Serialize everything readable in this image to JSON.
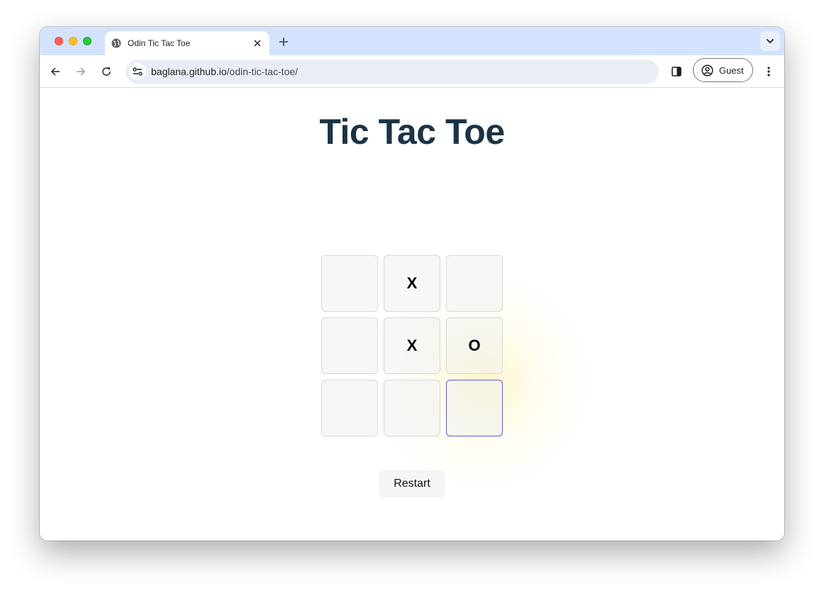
{
  "browser": {
    "tab": {
      "title": "Odin Tic Tac Toe",
      "favicon": "globe-icon"
    },
    "address_bar": {
      "host": "baglana.github.io",
      "path": "/odin-tic-tac-toe/"
    },
    "profile": {
      "label": "Guest"
    }
  },
  "page": {
    "title": "Tic Tac Toe",
    "board": {
      "cells": [
        "",
        "X",
        "",
        "",
        "X",
        "O",
        "",
        "",
        ""
      ],
      "focused_cell": 8
    },
    "restart_label": "Restart"
  },
  "colors": {
    "title": "#1c3346",
    "tabbar": "#d3e3fd",
    "focus_border": "#5b5bd6"
  }
}
